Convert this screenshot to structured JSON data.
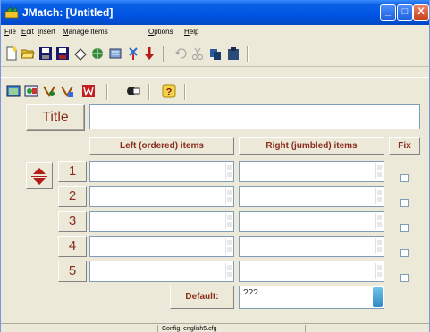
{
  "window": {
    "title": "JMatch: [Untitled]",
    "controls": {
      "minimize": "_",
      "maximize": "□",
      "close": "X"
    }
  },
  "menubar": {
    "items": [
      {
        "label": "File",
        "underline": "F",
        "rest": "ile"
      },
      {
        "label": "Edit",
        "underline": "E",
        "rest": "dit"
      },
      {
        "label": "Insert",
        "underline": "I",
        "rest": "nsert"
      },
      {
        "label": "Manage Items",
        "underline": "M",
        "rest": "anage Items"
      },
      {
        "label": "Options",
        "underline": "O",
        "rest": "ptions"
      },
      {
        "label": "Help",
        "underline": "H",
        "rest": "elp"
      }
    ]
  },
  "toolbar1": {
    "icons": [
      "new-file-icon",
      "open-folder-icon",
      "save-icon",
      "save-as-icon",
      "eraser-icon",
      "web-page-icon",
      "export-icon",
      "add-icon",
      "undo-icon",
      "cut-icon",
      "copy-icon",
      "paste-icon"
    ]
  },
  "toolbar2": {
    "icons": [
      "export-web-icon",
      "export-drag-drop-icon",
      "export-html-icon",
      "export-java-icon",
      "export-word-icon",
      "config-icon",
      "help-icon"
    ]
  },
  "main": {
    "title_button_label": "Title",
    "title_value": "",
    "headers": {
      "left": "Left (ordered) items",
      "right": "Right (jumbled) items",
      "fix": "Fix"
    },
    "rows": [
      {
        "num": "1",
        "left": "",
        "right": "",
        "fix": false
      },
      {
        "num": "2",
        "left": "",
        "right": "",
        "fix": false
      },
      {
        "num": "3",
        "left": "",
        "right": "",
        "fix": false
      },
      {
        "num": "4",
        "left": "",
        "right": "",
        "fix": false
      },
      {
        "num": "5",
        "left": "",
        "right": "",
        "fix": false
      }
    ],
    "default_label": "Default:",
    "default_value": "???"
  },
  "statusbar": {
    "config": "Config: english5.cfg"
  },
  "colors": {
    "titlebar": "#0054e3",
    "label_red": "#8b2c1f",
    "arrow_red": "#b51919",
    "face": "#ece9d8"
  }
}
